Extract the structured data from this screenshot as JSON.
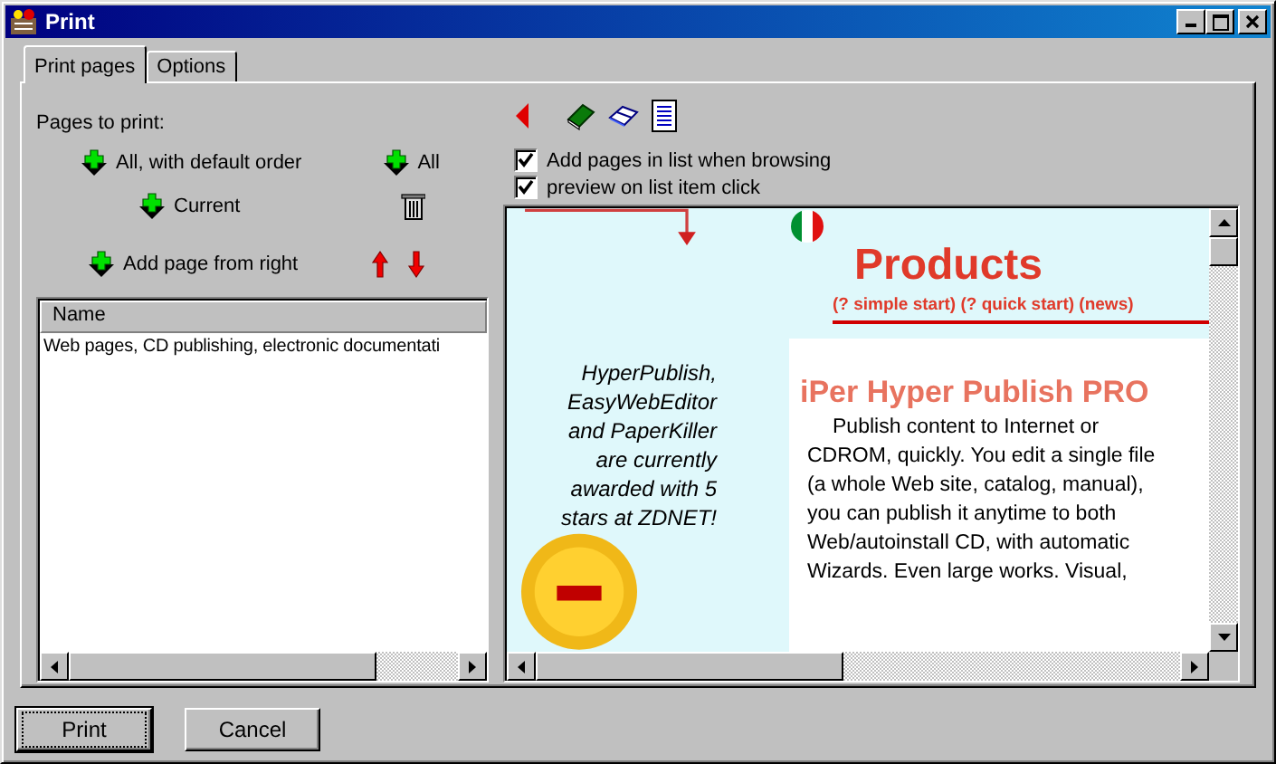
{
  "window": {
    "title": "Print"
  },
  "tabs": [
    {
      "label": "Print pages",
      "selected": true
    },
    {
      "label": "Options",
      "selected": false
    }
  ],
  "pages_to_print": {
    "label": "Pages to print:",
    "rows": [
      {
        "items": [
          {
            "kind": "add",
            "label": "All, with default order"
          },
          {
            "kind": "add",
            "label": "All"
          }
        ]
      },
      {
        "items": [
          {
            "kind": "add",
            "label": "Current"
          },
          {
            "kind": "delete"
          }
        ]
      },
      {
        "items": [
          {
            "kind": "add",
            "label": "Add page from right"
          },
          {
            "kind": "up"
          },
          {
            "kind": "down"
          }
        ]
      }
    ]
  },
  "list": {
    "columns": [
      "Name"
    ],
    "rows": [
      "Web pages, CD publishing, electronic documentati"
    ]
  },
  "toolbar": [
    {
      "kind": "back"
    },
    {
      "kind": "book"
    },
    {
      "kind": "open-book"
    },
    {
      "kind": "page"
    }
  ],
  "options": [
    {
      "label": "Add pages in list when browsing",
      "checked": true
    },
    {
      "label": "preview on list item click",
      "checked": true
    }
  ],
  "preview": {
    "heading": "Products",
    "links": "(? simple start) (? quick start) (news)",
    "sidebar_text": "HyperPublish,\nEasyWebEditor\nand PaperKiller\nare currently\nawarded with 5\nstars at ZDNET!",
    "product_title": "iPer Hyper Publish PRO",
    "body": "Publish content to Internet or\nCDROM, quickly. You edit a single file\n(a whole Web site, catalog, manual),\nyou can publish it anytime to both\nWeb/autoinstall CD, with automatic\nWizards. Even large works. Visual,"
  },
  "buttons": [
    {
      "label": "Print",
      "default": true
    },
    {
      "label": "Cancel",
      "default": false
    }
  ]
}
